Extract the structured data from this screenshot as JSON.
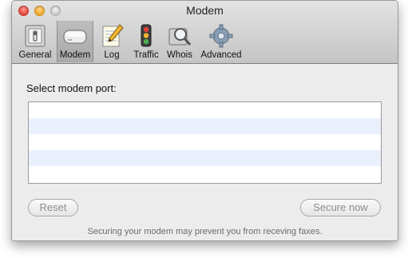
{
  "window": {
    "title": "Modem",
    "buttons": [
      "close",
      "minimize",
      "zoom"
    ]
  },
  "toolbar": {
    "items": [
      {
        "label": "General",
        "icon": "light-switch-icon"
      },
      {
        "label": "Modem",
        "icon": "modem-icon",
        "selected": true
      },
      {
        "label": "Log",
        "icon": "notepad-pencil-icon"
      },
      {
        "label": "Traffic",
        "icon": "traffic-light-icon"
      },
      {
        "label": "Whois",
        "icon": "magnifier-icon"
      },
      {
        "label": "Advanced",
        "icon": "gear-icon"
      }
    ]
  },
  "content": {
    "port_label": "Select modem port:",
    "ports": []
  },
  "buttons": {
    "reset_label": "Reset",
    "secure_label": "Secure now"
  },
  "note": "Securing your modem may prevent you from receving faxes.",
  "colors": {
    "accent_row": "#e9f0fb",
    "disabled_text": "#8d8d8d"
  }
}
